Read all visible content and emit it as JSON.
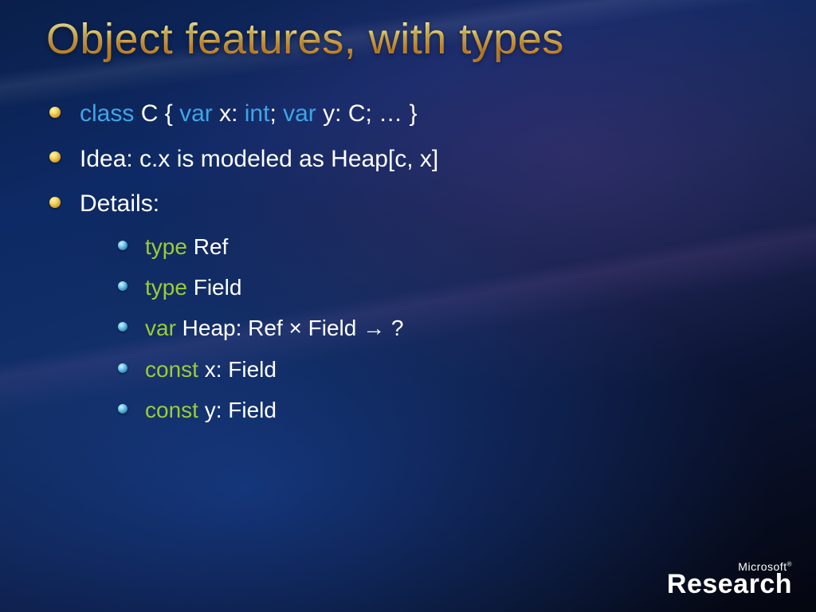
{
  "title": "Object features, with types",
  "bullets": {
    "b1": {
      "class": "class",
      "cname": " C { ",
      "var1": "var",
      "xdecl": " x: ",
      "int": "int",
      "semi1": ";  ",
      "var2": "var",
      "ydecl": " y: C;  … }"
    },
    "b2": "Idea:  c.x  is modeled as  Heap[c, x]",
    "b3": "Details:",
    "sub": {
      "s1": {
        "kw": "type",
        "rest": " Ref"
      },
      "s2": {
        "kw": "type",
        "rest": " Field"
      },
      "s3": {
        "kw": "var",
        "rest": " Heap:  Ref × Field → ?"
      },
      "s4": {
        "kw": "const",
        "rest": " x: Field"
      },
      "s5": {
        "kw": "const",
        "rest": " y: Field"
      }
    }
  },
  "logo": {
    "ms": "Microsoft",
    "tm": "®",
    "research": "Research"
  }
}
